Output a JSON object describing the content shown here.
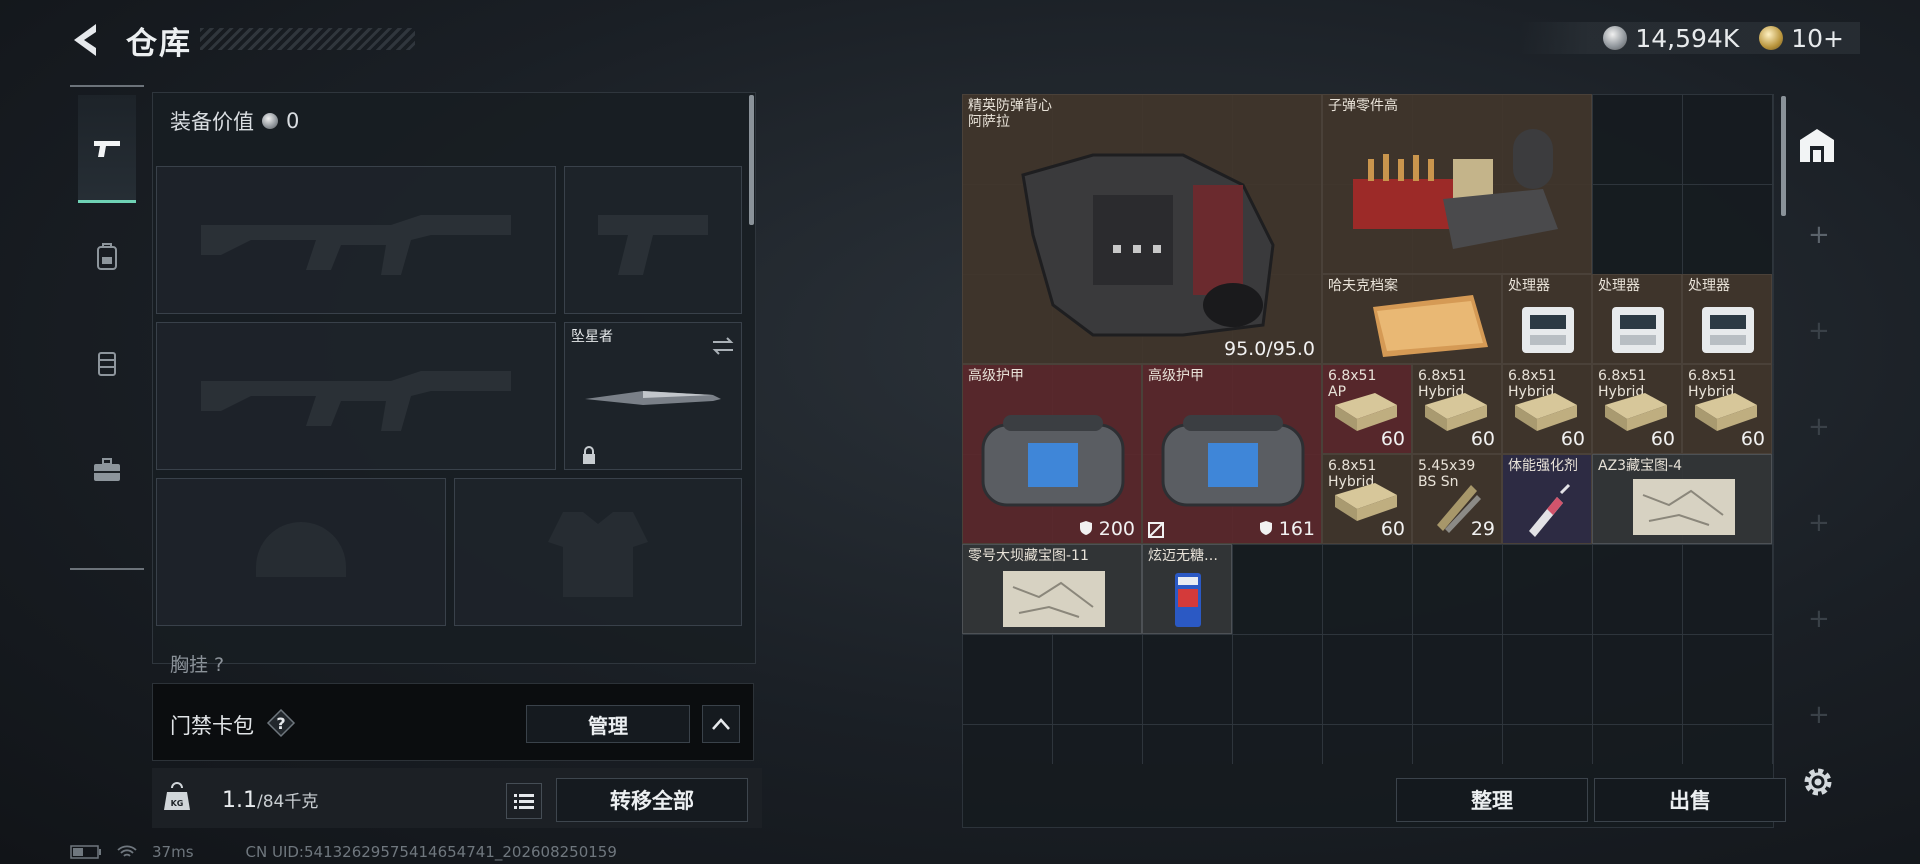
{
  "header": {
    "title": "仓库",
    "currency_primary": "14,594K",
    "currency_secondary": "10+"
  },
  "left_panel": {
    "equip_value_label": "装备价值",
    "equip_value": "0",
    "melee_slot_name": "坠星者",
    "chest_label": "胸挂 ?",
    "keycard_label": "门禁卡包",
    "manage_label": "管理",
    "weight_current": "1.1",
    "weight_max": "/84千克",
    "transfer_all_label": "转移全部"
  },
  "status": {
    "ping": "37ms",
    "uid": "CN UID:54132629575414654741_202608250159"
  },
  "storage": {
    "items": [
      {
        "name": "精英防弹背心\n阿萨拉",
        "count": "95.0/95.0",
        "color": "#423628"
      },
      {
        "name": "子弹零件高",
        "count": "",
        "color": "#423628"
      },
      {
        "name": "哈夫克档案",
        "count": "",
        "color": "#423628"
      },
      {
        "name": "处理器",
        "count": ""
      },
      {
        "name": "处理器",
        "count": ""
      },
      {
        "name": "处理器",
        "count": ""
      },
      {
        "name": "高级护甲",
        "count": "200"
      },
      {
        "name": "高级护甲",
        "count": "161"
      },
      {
        "name": "6.8x51\nAP",
        "count": "60"
      },
      {
        "name": "6.8x51\nHybrid",
        "count": "60"
      },
      {
        "name": "6.8x51\nHybrid",
        "count": "60"
      },
      {
        "name": "6.8x51\nHybrid",
        "count": "60"
      },
      {
        "name": "6.8x51\nHybrid",
        "count": "60"
      },
      {
        "name": "6.8x51\nHybrid",
        "count": "60"
      },
      {
        "name": "5.45x39\nBS Sn",
        "count": "29"
      },
      {
        "name": "体能强化剂",
        "count": ""
      },
      {
        "name": "AZ3藏宝图-4",
        "count": ""
      },
      {
        "name": "零号大坝藏宝图-11",
        "count": ""
      },
      {
        "name": "炫迈无糖…",
        "count": ""
      }
    ],
    "sort_label": "整理",
    "sell_label": "出售"
  },
  "colors": {
    "accent_teal": "#6fd2b5",
    "item_brown": "#423628",
    "item_red": "#5c282c",
    "item_purple": "#302c46"
  }
}
